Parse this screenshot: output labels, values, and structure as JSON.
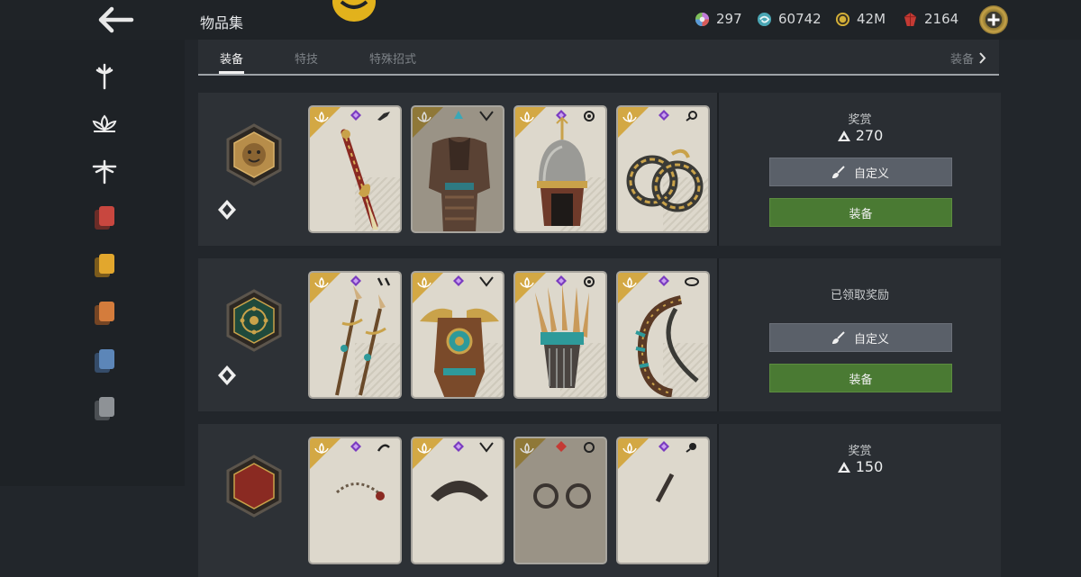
{
  "header": {
    "back_icon": "arrow-left-icon",
    "title": "物品集",
    "currencies": [
      {
        "icon": "rainbow-orb-icon",
        "value": "297",
        "color": "#c07ad8"
      },
      {
        "icon": "steel-swirl-icon",
        "value": "60742",
        "color": "#4aa6b4"
      },
      {
        "icon": "gold-coin-icon",
        "value": "42M",
        "color": "#d4b038"
      },
      {
        "icon": "red-gem-icon",
        "value": "2164",
        "color": "#c43a34"
      }
    ],
    "add_icon": "plus-circle-icon"
  },
  "sidebar": {
    "items": [
      {
        "name": "sword-emblem-icon"
      },
      {
        "name": "lotus-icon"
      },
      {
        "name": "dragonfly-icon"
      },
      {
        "name": "red-cards-icon",
        "color": "#c8473f"
      },
      {
        "name": "yellow-cards-icon",
        "color": "#e2a72d"
      },
      {
        "name": "orange-cards-icon",
        "color": "#d47c3c"
      },
      {
        "name": "blue-cards-icon",
        "color": "#5c86b8"
      },
      {
        "name": "grey-cards-icon",
        "color": "#8e9296"
      }
    ]
  },
  "tabs": {
    "items": [
      "装备",
      "特技",
      "特殊招式"
    ],
    "active": "装备",
    "next_label": "装备"
  },
  "rows": [
    {
      "reward_label": "奖赏",
      "reward_value": "270",
      "customize_label": "自定义",
      "equip_label": "装备",
      "emblem": "lion-emblem-icon",
      "cards": [
        "sword-card",
        "armor-card",
        "helmet-card",
        "ring-card"
      ]
    },
    {
      "reward_label": "已领取奖励",
      "customize_label": "自定义",
      "equip_label": "装备",
      "emblem": "sun-wheel-emblem-icon",
      "cards": [
        "spear-card",
        "feather-armor-card",
        "feather-helm-card",
        "scythe-card"
      ]
    },
    {
      "reward_label": "奖赏",
      "reward_value": "150",
      "emblem": "red-emblem-icon",
      "cards": [
        "chain-card",
        "shoulder-card",
        "dim-card",
        "weapon-card"
      ]
    }
  ]
}
